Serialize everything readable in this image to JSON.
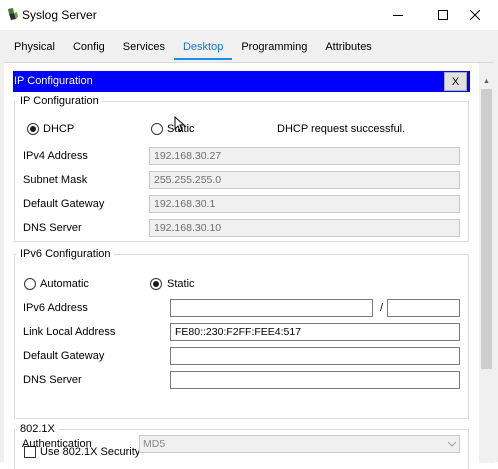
{
  "window": {
    "title": "Syslog Server",
    "icon": "server-app-icon"
  },
  "tabs": [
    "Physical",
    "Config",
    "Services",
    "Desktop",
    "Programming",
    "Attributes"
  ],
  "active_tab": "Desktop",
  "ip_config": {
    "bar_title": "IP Configuration",
    "close_label": "X",
    "ipv4": {
      "group_label": "IP Configuration",
      "dhcp_label": "DHCP",
      "static_label": "Static",
      "mode": "DHCP",
      "status": "DHCP request successful.",
      "fields": [
        {
          "label": "IPv4 Address",
          "value": "192.168.30.27"
        },
        {
          "label": "Subnet Mask",
          "value": "255.255.255.0"
        },
        {
          "label": "Default Gateway",
          "value": "192.168.30.1"
        },
        {
          "label": "DNS Server",
          "value": "192.168.30.10"
        }
      ]
    },
    "ipv6": {
      "group_label": "IPv6 Configuration",
      "automatic_label": "Automatic",
      "static_label": "Static",
      "mode": "Static",
      "address_label": "IPv6 Address",
      "address_value": "",
      "prefix_separator": "/",
      "prefix_value": "",
      "link_local_label": "Link Local Address",
      "link_local_value": "FE80::230:F2FF:FEE4:517",
      "gateway_label": "Default Gateway",
      "gateway_value": "",
      "dns_label": "DNS Server",
      "dns_value": ""
    },
    "dot1x": {
      "group_label": "802.1X",
      "use_label": "Use 802.1X Security",
      "use_checked": false,
      "auth_label": "Authentication",
      "auth_value": "MD5"
    }
  }
}
